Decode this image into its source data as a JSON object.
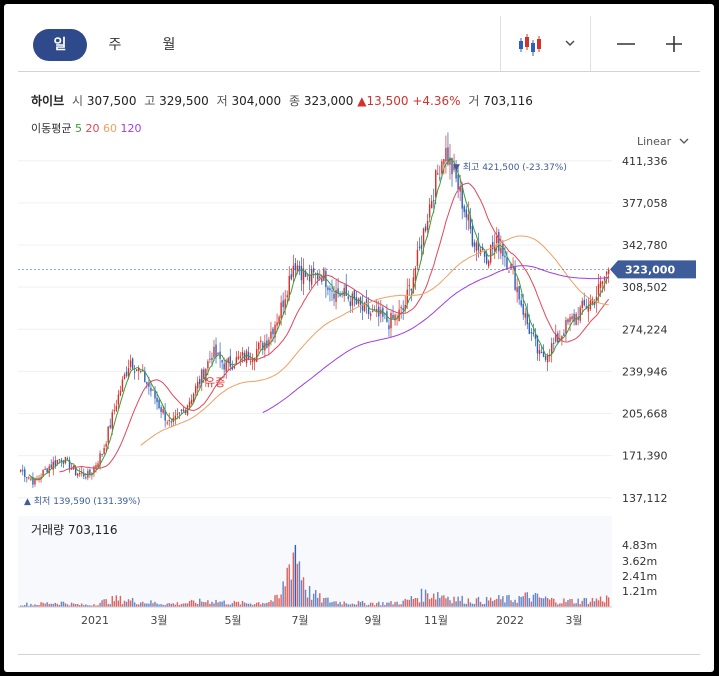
{
  "toolbar": {
    "periods": [
      "일",
      "주",
      "월"
    ],
    "active_period": "일"
  },
  "quote": {
    "name": "하이브",
    "open_label": "시",
    "open": "307,500",
    "high_label": "고",
    "high": "329,500",
    "low_label": "저",
    "low": "304,000",
    "close_label": "종",
    "close": "323,000",
    "change": "13,500",
    "change_pct": "+4.36%",
    "volume_label": "거",
    "volume": "703,116"
  },
  "ma_legend": {
    "label": "이동평균",
    "items": [
      {
        "period": "5",
        "color": "#3a9d3a"
      },
      {
        "period": "20",
        "color": "#e0475a"
      },
      {
        "period": "60",
        "color": "#f0a060"
      },
      {
        "period": "120",
        "color": "#a040e0"
      }
    ]
  },
  "scale_selector": "Linear",
  "colors": {
    "up": "#d2322d",
    "down": "#2f5fb8",
    "accent": "#2f4a8a",
    "badge": "#3e5b9a"
  },
  "chart_data": {
    "type": "candlestick",
    "price_axis": {
      "ticks": [
        411336,
        377058,
        342780,
        308502,
        274224,
        239946,
        205668,
        171390,
        137112
      ],
      "range": [
        128000,
        425000
      ]
    },
    "volume_axis": {
      "ticks": [
        "4.83m",
        "3.62m",
        "2.41m",
        "1.21m"
      ]
    },
    "x_ticks": [
      "2021",
      "3월",
      "5월",
      "7월",
      "9월",
      "11월",
      "2022",
      "3월"
    ],
    "current_price_label": "323,000",
    "high_annotation": "최고 421,500 (-23.37%)",
    "low_annotation": "최저 139,590 (131.39%)",
    "event_marker": "유증",
    "volume_title": "거래량",
    "volume_value": "703,116",
    "price_path": [
      160000,
      150000,
      162000,
      170000,
      158000,
      155000,
      175000,
      215000,
      250000,
      235000,
      215000,
      195000,
      210000,
      230000,
      255000,
      245000,
      250000,
      255000,
      265000,
      290000,
      330000,
      315000,
      320000,
      305000,
      300000,
      290000,
      285000,
      280000,
      290000,
      330000,
      380000,
      421500,
      390000,
      350000,
      335000,
      345000,
      320000,
      280000,
      250000,
      262000,
      278000,
      290000,
      300000,
      323000
    ],
    "volume_path": [
      0.25,
      0.2,
      0.3,
      0.35,
      0.2,
      0.15,
      0.4,
      0.6,
      0.5,
      0.4,
      0.3,
      0.25,
      0.3,
      0.4,
      0.5,
      0.35,
      0.3,
      0.3,
      0.4,
      0.7,
      4.83,
      1.2,
      0.6,
      0.4,
      0.35,
      0.3,
      0.3,
      0.3,
      0.4,
      0.8,
      1.1,
      0.9,
      0.6,
      0.5,
      0.5,
      0.6,
      0.6,
      0.8,
      0.7,
      0.5,
      0.45,
      0.5,
      0.55,
      0.7
    ]
  }
}
